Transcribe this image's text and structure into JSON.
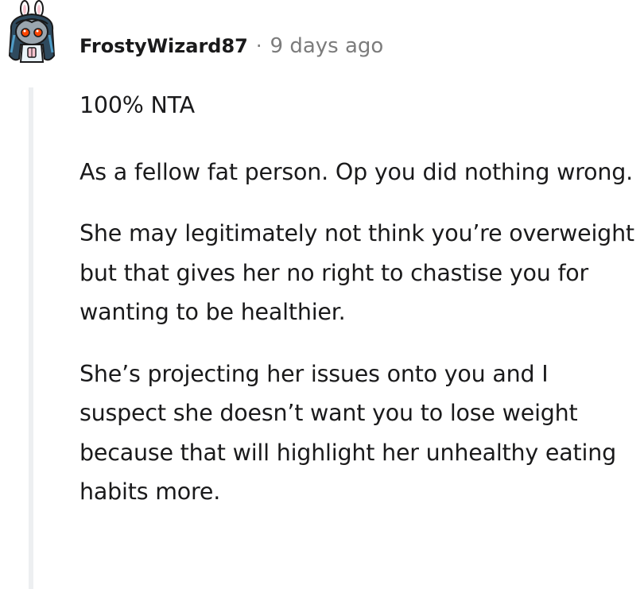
{
  "comment": {
    "author": "FrostyWizard87",
    "separator": "·",
    "timestamp": "9 days ago",
    "paragraphs": [
      "100% NTA",
      "As a fellow fat person. Op you did nothing wrong.",
      "She may legitimately not think you’re overweight but that gives her no right to chastise you for wanting to be healthier.",
      "She’s projecting her issues onto you and I suspect she doesn’t want you to lose weight because that will highlight her unhealthy eating habits more."
    ]
  }
}
